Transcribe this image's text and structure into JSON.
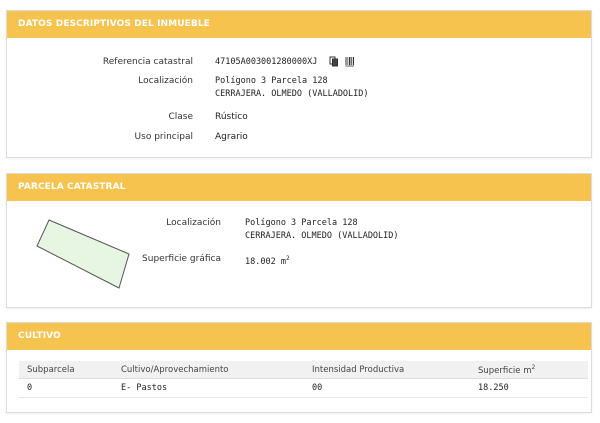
{
  "descriptive": {
    "title": "DATOS DESCRIPTIVOS DEL INMUEBLE",
    "ref_label": "Referencia catastral",
    "ref_value": "47105A003001280000XJ",
    "loc_label": "Localización",
    "loc_line1": "Polígono 3 Parcela 128",
    "loc_line2": "CERRAJERA. OLMEDO (VALLADOLID)",
    "class_label": "Clase",
    "class_value": "Rústico",
    "use_label": "Uso principal",
    "use_value": "Agrario"
  },
  "parcel": {
    "title": "PARCELA CATASTRAL",
    "loc_label": "Localización",
    "loc_line1": "Polígono 3 Parcela 128",
    "loc_line2": "CERRAJERA. OLMEDO (VALLADOLID)",
    "area_label": "Superficie gráfica",
    "area_value": "18.002 m",
    "area_unit_sup": "2",
    "shape_fill": "#e6f6e3",
    "shape_stroke": "#555555"
  },
  "cultivo": {
    "title": "CULTIVO",
    "headers": [
      "Subparcela",
      "Cultivo/Aprovechamiento",
      "Intensidad Productiva",
      "Superficie m"
    ],
    "header_sup": "2",
    "rows": [
      [
        "0",
        "E- Pastos",
        "00",
        "18.250"
      ]
    ]
  },
  "colors": {
    "header_bg": "#f7c34f",
    "header_text": "#ffffff"
  }
}
